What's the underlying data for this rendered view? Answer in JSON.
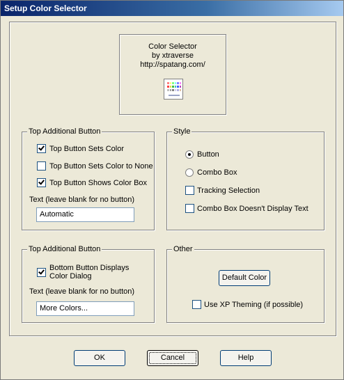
{
  "window": {
    "title": "Setup Color Selector"
  },
  "preview": {
    "line1": "Color Selector",
    "line2": "by xtraverse",
    "line3": "http://spatang.com/",
    "icon": "color-palette-icon"
  },
  "top_group": {
    "label": "Top Additional Button",
    "options": [
      {
        "label": "Top Button Sets Color",
        "checked": true
      },
      {
        "label": "Top Button Sets Color to None",
        "checked": false
      },
      {
        "label": "Top Button Shows Color Box",
        "checked": true
      }
    ],
    "text_label": "Text (leave blank for no button)",
    "text_value": "Automatic"
  },
  "style_group": {
    "label": "Style",
    "radio_button": {
      "label": "Button",
      "selected": true
    },
    "radio_combo": {
      "label": "Combo Box",
      "selected": false
    },
    "tracking": {
      "label": "Tracking Selection",
      "checked": false
    },
    "combo_no_text": {
      "label": "Combo Box Doesn't Display Text",
      "checked": false
    }
  },
  "bottom_group": {
    "label": "Top Additional Button",
    "option_line1": "Bottom Button Displays",
    "option_line2": "Color Dialog",
    "option_checked": true,
    "text_label": "Text (leave blank for no button)",
    "text_value": "More Colors..."
  },
  "other_group": {
    "label": "Other",
    "default_color_button": "Default Color",
    "xp_theming": {
      "label": "Use XP Theming (if possible)",
      "checked": false
    }
  },
  "buttons": {
    "ok": "OK",
    "cancel": "Cancel",
    "help": "Help"
  }
}
